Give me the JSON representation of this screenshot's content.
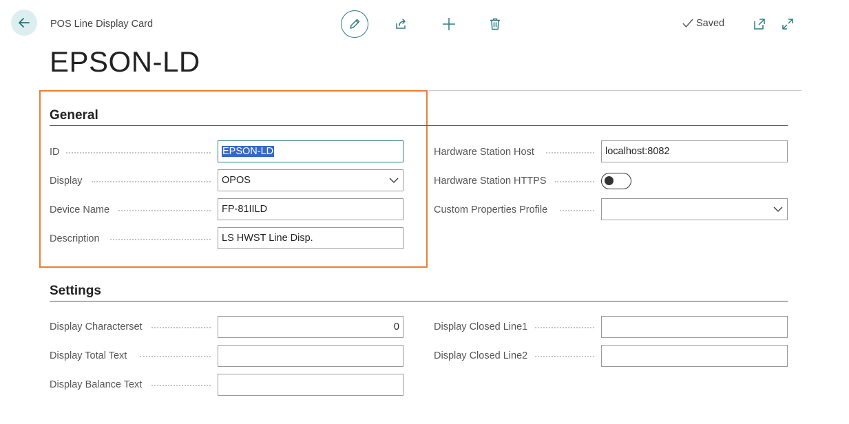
{
  "header": {
    "caption": "POS Line Display Card",
    "title": "EPSON-LD",
    "saved_label": "Saved"
  },
  "general": {
    "title": "General",
    "id": {
      "label": "ID",
      "value": "EPSON-LD"
    },
    "display": {
      "label": "Display",
      "value": "OPOS"
    },
    "device_name": {
      "label": "Device Name",
      "value": "FP-81IILD"
    },
    "description": {
      "label": "Description",
      "value": "LS HWST Line Disp."
    },
    "hw_host": {
      "label": "Hardware Station Host",
      "value": "localhost:8082"
    },
    "hw_https": {
      "label": "Hardware Station HTTPS",
      "value": false
    },
    "custom_profile": {
      "label": "Custom Properties Profile",
      "value": ""
    }
  },
  "settings": {
    "title": "Settings",
    "charset": {
      "label": "Display Characterset",
      "value": "0"
    },
    "total_text": {
      "label": "Display Total Text",
      "value": ""
    },
    "balance_text": {
      "label": "Display Balance Text",
      "value": ""
    },
    "closed_line1": {
      "label": "Display Closed Line1",
      "value": ""
    },
    "closed_line2": {
      "label": "Display Closed Line2",
      "value": ""
    }
  },
  "colors": {
    "accent": "#2a7d85",
    "highlight": "#ee7f2e",
    "selection": "#3867c9"
  },
  "icons": [
    "back-arrow-icon",
    "pencil-icon",
    "share-icon",
    "plus-icon",
    "trash-icon",
    "checkmark-icon",
    "open-new-window-icon",
    "expand-icon",
    "chevron-down-icon"
  ]
}
